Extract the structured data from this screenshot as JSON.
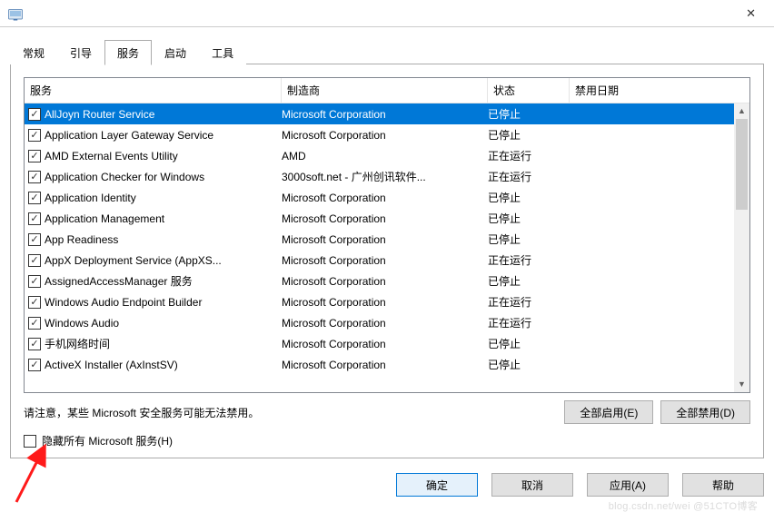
{
  "tabs": [
    {
      "label": "常规"
    },
    {
      "label": "引导"
    },
    {
      "label": "服务",
      "active": true
    },
    {
      "label": "启动"
    },
    {
      "label": "工具"
    }
  ],
  "columns": {
    "service": "服务",
    "manufacturer": "制造商",
    "status": "状态",
    "disable_date": "禁用日期"
  },
  "rows": [
    {
      "checked": true,
      "selected": true,
      "service": "AllJoyn Router Service",
      "manufacturer": "Microsoft Corporation",
      "status": "已停止"
    },
    {
      "checked": true,
      "service": "Application Layer Gateway Service",
      "manufacturer": "Microsoft Corporation",
      "status": "已停止"
    },
    {
      "checked": true,
      "service": "AMD External Events Utility",
      "manufacturer": "AMD",
      "status": "正在运行"
    },
    {
      "checked": true,
      "service": "Application Checker for Windows",
      "manufacturer": "3000soft.net - 广州创讯软件...",
      "status": "正在运行"
    },
    {
      "checked": true,
      "service": "Application Identity",
      "manufacturer": "Microsoft Corporation",
      "status": "已停止"
    },
    {
      "checked": true,
      "service": "Application Management",
      "manufacturer": "Microsoft Corporation",
      "status": "已停止"
    },
    {
      "checked": true,
      "service": "App Readiness",
      "manufacturer": "Microsoft Corporation",
      "status": "已停止"
    },
    {
      "checked": true,
      "service": "AppX Deployment Service (AppXS...",
      "manufacturer": "Microsoft Corporation",
      "status": "正在运行"
    },
    {
      "checked": true,
      "service": "AssignedAccessManager 服务",
      "manufacturer": "Microsoft Corporation",
      "status": "已停止"
    },
    {
      "checked": true,
      "service": "Windows Audio Endpoint Builder",
      "manufacturer": "Microsoft Corporation",
      "status": "正在运行"
    },
    {
      "checked": true,
      "service": "Windows Audio",
      "manufacturer": "Microsoft Corporation",
      "status": "正在运行"
    },
    {
      "checked": true,
      "service": "手机网络时间",
      "manufacturer": "Microsoft Corporation",
      "status": "已停止"
    },
    {
      "checked": true,
      "service": "ActiveX Installer (AxInstSV)",
      "manufacturer": "Microsoft Corporation",
      "status": "已停止"
    }
  ],
  "note": "请注意，某些 Microsoft 安全服务可能无法禁用。",
  "buttons": {
    "enable_all": "全部启用(E)",
    "disable_all": "全部禁用(D)",
    "ok": "确定",
    "cancel": "取消",
    "apply": "应用(A)",
    "help": "帮助"
  },
  "hide_ms_label": "隐藏所有 Microsoft 服务(H)",
  "checkmark": "✓",
  "watermark": "blog.csdn.net/wei @51CTO博客"
}
